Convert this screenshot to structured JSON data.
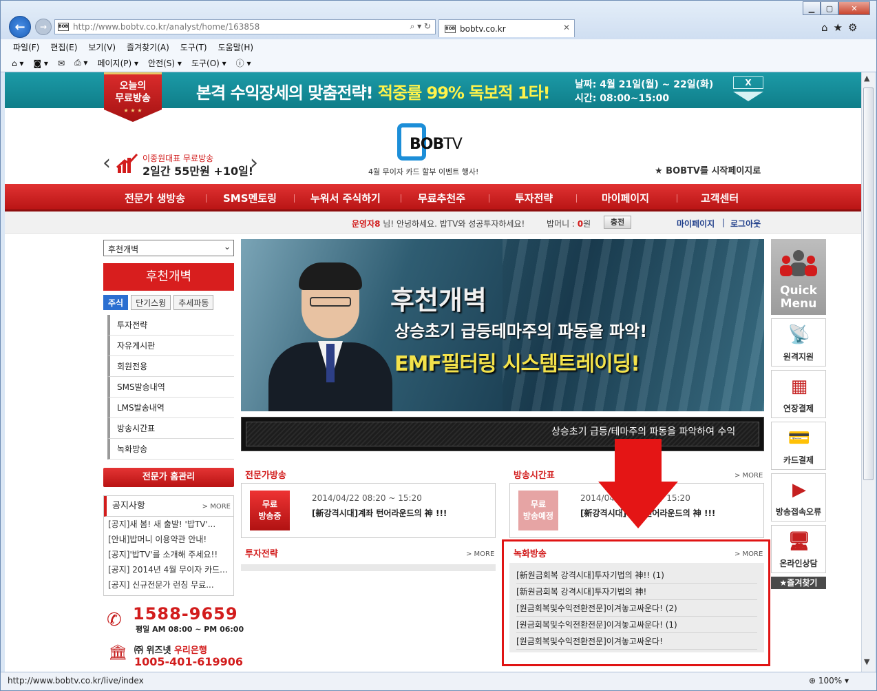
{
  "browser": {
    "address": "http://www.bobtv.co.kr/analyst/home/163858",
    "tab_title": "bobtv.co.kr",
    "status_url": "http://www.bobtv.co.kr/live/index",
    "zoom": "100%",
    "menu": [
      "파일(F)",
      "편집(E)",
      "보기(V)",
      "즐겨찾기(A)",
      "도구(T)",
      "도움말(H)"
    ],
    "commands": [
      "페이지(P) ▾",
      "안전(S) ▾",
      "도구(O) ▾"
    ]
  },
  "banner": {
    "ribbon_line1": "오늘의",
    "ribbon_line2": "무료방송",
    "text_white": "본격 수익장세의 맞춤전략!",
    "text_yellow": "적중률 99% 독보적 1타!",
    "date": "날짜: 4월 21일(월) ~ 22일(화)",
    "time": "시간: 08:00~15:00",
    "close": "X"
  },
  "header": {
    "logo_bob": "BOB",
    "logo_tv": "TV",
    "logo_sub": "4월 무이자 카드 할부 이벤트 행사!",
    "promo_small": "이종원대표 무료방송",
    "promo_big": "2일간 55만원 +10일!",
    "start_page": "★ BOBTV를 시작페이지로"
  },
  "nav": [
    "전문가 생방송",
    "SMS멘토링",
    "누워서 주식하기",
    "무료추천주",
    "투자전략",
    "마이페이지",
    "고객센터"
  ],
  "userbar": {
    "name": "운영자8",
    "greeting": " 님! 안녕하세요. 밥TV와 성공투자하세요!",
    "money_label": "밥머니 : ",
    "money_value": "0",
    "money_unit": "원",
    "charge": "충전",
    "mypage": "마이페이지",
    "sep": "|",
    "logout": "로그아웃"
  },
  "sidebar": {
    "select_value": "후천개벽",
    "analyst": "후천개벽",
    "tabs": [
      "주식",
      "단기스윙",
      "추세파동"
    ],
    "menu": [
      "투자전략",
      "자유게시판",
      "회원전용",
      "SMS발송내역",
      "LMS발송내역",
      "방송시간표",
      "녹화방송"
    ],
    "home_button": "전문가 홈관리",
    "notice_title": "공지사항",
    "more": "> MORE",
    "notices": [
      "[공지]새 봄! 새 출발! '밥TV'...",
      "[안내]밥머니 이용약관 안내!",
      "[공지]'밥TV'를 소개해 주세요!!",
      "[공지] 2014년 4월 무이자 카드...",
      "[공지] 신규전문가 런칭 무료..."
    ],
    "phone": "1588-9659",
    "hours": "평일 AM 08:00 ~ PM 06:00",
    "bank_company": "㈜ 위즈넷",
    "bank_name": "우리은행",
    "bank_account": "1005-401-619906"
  },
  "hero": {
    "title": "후천개벽",
    "sub1": "상승초기 급등테마주의 파동을 파악!",
    "sub2": "EMF필터링 시스템트레이딩!",
    "ticker": "상승초기 급등/테마주의 파동을 파악하여 수익"
  },
  "sections": {
    "live_title": "전문가방송",
    "schedule_title": "방송시간표",
    "strategy_title": "투자전략",
    "recorded_title": "녹화방송",
    "more": "> MORE",
    "live_badge1": "무료",
    "live_badge2": "방송중",
    "live_time": "2014/04/22 08:20 ~ 15:20",
    "live_program": "[新강격시대]계좌 턴어라운드의 神 !!!",
    "sched_badge1": "무료",
    "sched_badge2": "방송예정",
    "sched_time": "2014/04/22 08:20 ~ 15:20",
    "sched_program": "[新강격시대]계좌 턴어라운드의 神 !!!",
    "recorded": [
      "[新원금회복 강격시대]투자기법의 神!! (1)",
      "[新원금회복 강격시대]투자기법의 神!",
      "[원금회복및수익전환전문]이겨놓고싸운다! (2)",
      "[원금회복및수익전환전문]이겨놓고싸운다! (1)",
      "[원금회복및수익전환전문]이겨놓고싸운다!"
    ]
  },
  "quickmenu": {
    "title1": "Quick",
    "title2": "Menu",
    "items": [
      "원격지원",
      "연장결제",
      "카드결제",
      "방송접속오류",
      "온라인상담"
    ],
    "favorites": "★즐겨찾기"
  }
}
